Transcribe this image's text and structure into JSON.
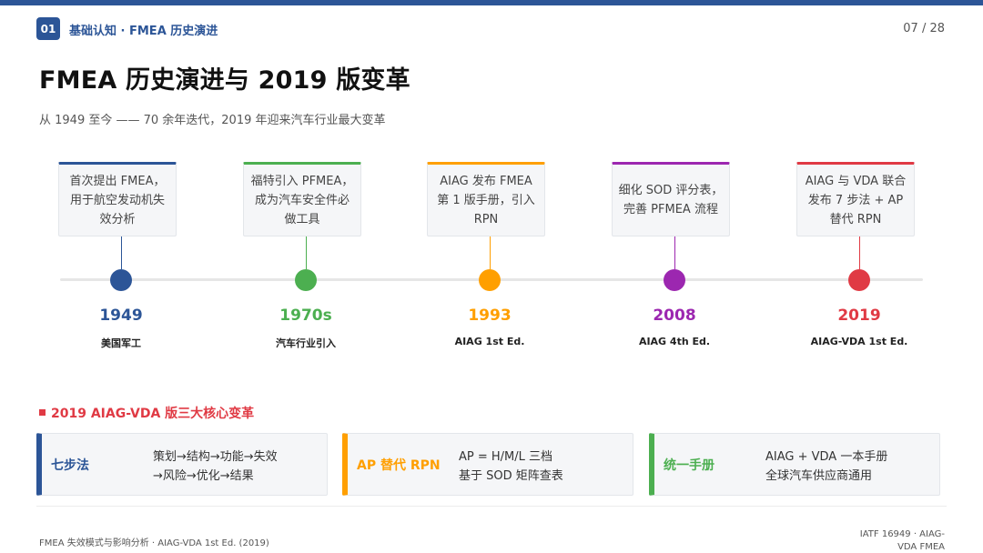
{
  "header": {
    "section_number": "01",
    "section_title": "基础认知 · FMEA 历史演进",
    "page_indicator": "07 / 28",
    "accent_color": "#2c5597"
  },
  "title": "FMEA 历史演进与 2019 版变革",
  "subtitle": "从 1949 至今 —— 70 余年迭代，2019 年迎来汽车行业最大变革",
  "timeline": [
    {
      "year": "1949",
      "label": "美国军工",
      "description": "首次提出 FMEA，用于航空发动机失效分析",
      "color": "#2c5597"
    },
    {
      "year": "1970s",
      "label": "汽车行业引入",
      "description": "福特引入 PFMEA，成为汽车安全件必做工具",
      "color": "#4caf50"
    },
    {
      "year": "1993",
      "label": "AIAG 1st Ed.",
      "description": "AIAG 发布 FMEA 第 1 版手册，引入 RPN",
      "color": "#ff9f00"
    },
    {
      "year": "2008",
      "label": "AIAG 4th Ed.",
      "description": "细化 SOD 评分表，完善 PFMEA 流程",
      "color": "#9c27b0"
    },
    {
      "year": "2019",
      "label": "AIAG-VDA 1st Ed.",
      "description": "AIAG 与 VDA 联合发布 7 步法 + AP 替代 RPN",
      "color": "#e03a44"
    }
  ],
  "changes": {
    "heading": "2019 AIAG-VDA 版三大核心变革",
    "accent_color": "#e03a44",
    "items": [
      {
        "name": "七步法",
        "lines": [
          "策划→结构→功能→失效",
          "→风险→优化→结果"
        ],
        "color": "#2c5597"
      },
      {
        "name": "AP 替代 RPN",
        "lines": [
          "AP = H/M/L 三档",
          "基于 SOD 矩阵查表"
        ],
        "color": "#ff9f00"
      },
      {
        "name": "统一手册",
        "lines": [
          "AIAG + VDA 一本手册",
          "全球汽车供应商通用"
        ],
        "color": "#4caf50"
      }
    ]
  },
  "footer": {
    "left": "FMEA 失效模式与影响分析 · AIAG-VDA 1st Ed. (2019)",
    "right": "IATF 16949 · AIAG-VDA FMEA"
  }
}
